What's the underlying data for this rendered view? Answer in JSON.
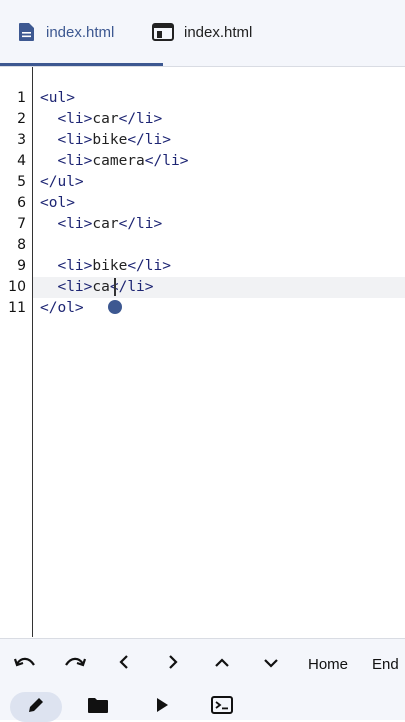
{
  "tabs": [
    {
      "label": "index.html",
      "icon": "file-icon",
      "active": true
    },
    {
      "label": "index.html",
      "icon": "browser-preview-icon",
      "active": false
    }
  ],
  "editor": {
    "lines": [
      {
        "num": "1",
        "code": [
          {
            "t": "tag",
            "v": "<ul>"
          }
        ]
      },
      {
        "num": "2",
        "code": [
          {
            "t": "txt",
            "v": "  "
          },
          {
            "t": "tag",
            "v": "<li>"
          },
          {
            "t": "txt",
            "v": "car"
          },
          {
            "t": "tag",
            "v": "</li>"
          }
        ]
      },
      {
        "num": "3",
        "code": [
          {
            "t": "txt",
            "v": "  "
          },
          {
            "t": "tag",
            "v": "<li>"
          },
          {
            "t": "txt",
            "v": "bike"
          },
          {
            "t": "tag",
            "v": "</li>"
          }
        ]
      },
      {
        "num": "4",
        "code": [
          {
            "t": "txt",
            "v": "  "
          },
          {
            "t": "tag",
            "v": "<li>"
          },
          {
            "t": "txt",
            "v": "camera"
          },
          {
            "t": "tag",
            "v": "</li>"
          }
        ]
      },
      {
        "num": "5",
        "code": [
          {
            "t": "tag",
            "v": "</ul>"
          }
        ]
      },
      {
        "num": "6",
        "code": [
          {
            "t": "tag",
            "v": "<ol>"
          }
        ]
      },
      {
        "num": "7",
        "code": [
          {
            "t": "txt",
            "v": "  "
          },
          {
            "t": "tag",
            "v": "<li>"
          },
          {
            "t": "txt",
            "v": "car"
          },
          {
            "t": "tag",
            "v": "</li>"
          }
        ]
      },
      {
        "num": "8",
        "code": []
      },
      {
        "num": "9",
        "code": [
          {
            "t": "txt",
            "v": "  "
          },
          {
            "t": "tag",
            "v": "<li>"
          },
          {
            "t": "txt",
            "v": "bike"
          },
          {
            "t": "tag",
            "v": "</li>"
          }
        ]
      },
      {
        "num": "10",
        "code": [
          {
            "t": "txt",
            "v": "  "
          },
          {
            "t": "tag",
            "v": "<li>"
          },
          {
            "t": "txt",
            "v": "ca"
          },
          {
            "t": "tag",
            "v": "</li>"
          }
        ],
        "active": true
      },
      {
        "num": "11",
        "code": [
          {
            "t": "tag",
            "v": "</ol>"
          }
        ]
      }
    ]
  },
  "keys": {
    "undo": "undo-icon",
    "redo": "redo-icon",
    "left": "chevron-left-icon",
    "right": "chevron-right-icon",
    "up": "chevron-up-icon",
    "down": "chevron-down-icon",
    "home_label": "Home",
    "end_label": "End"
  },
  "bottom_nav": [
    {
      "icon": "pencil-icon",
      "active": true
    },
    {
      "icon": "folder-icon",
      "active": false
    },
    {
      "icon": "play-icon",
      "active": false
    },
    {
      "icon": "terminal-icon",
      "active": false
    }
  ],
  "colors": {
    "accent": "#3d5891",
    "tag": "#1d2573",
    "panel": "#f4f6fb"
  }
}
